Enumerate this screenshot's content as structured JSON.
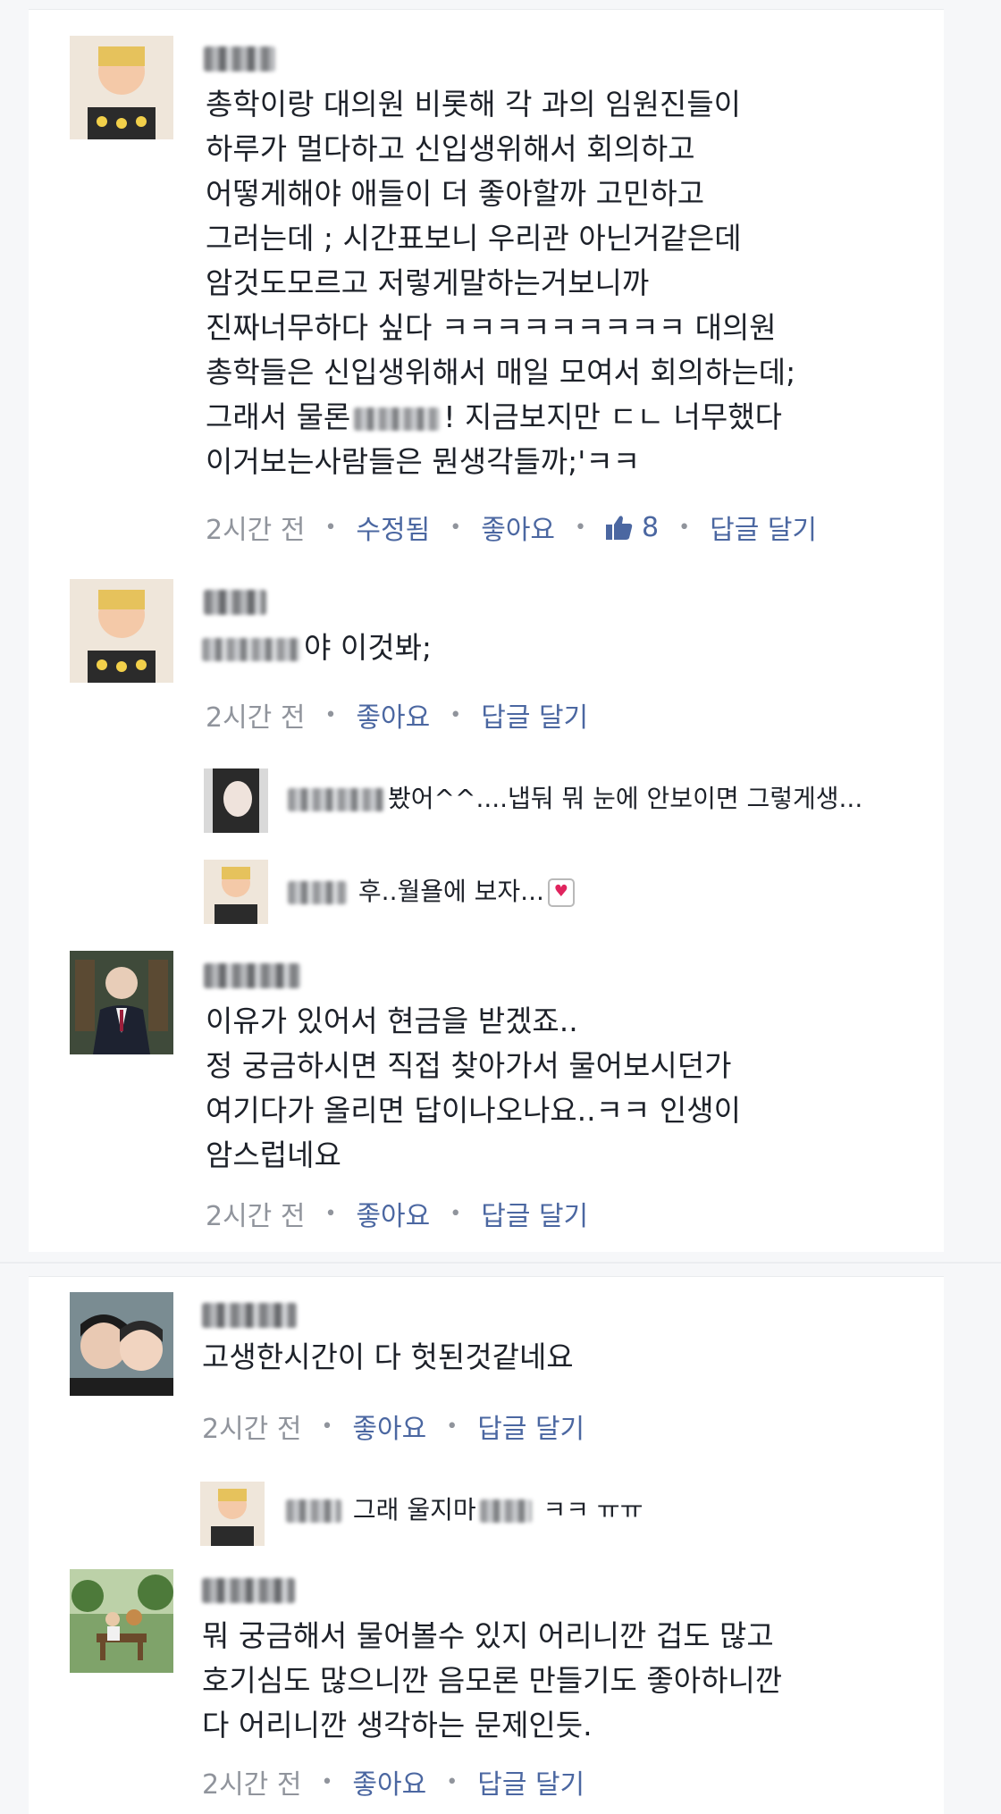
{
  "comments": [
    {
      "text": "총학이랑 대의원 비롯해 각 과의 임원진들이\n하루가 멀다하고 신입생위해서 회의하고\n어떻게해야 애들이 더 좋아할까 고민하고\n그러는데 ; 시간표보니 우리관 아닌거같은데\n암것도모르고 저렇게말하는거보니까\n진짜너무하다 싶다 ㅋㅋㅋㅋㅋㅋㅋㅋㅋ 대의원\n총학들은 신입생위해서 매일 모여서 회의하는데;\n그래서 물론",
      "text_after_blur": "! 지금보지만 ㄷㄴ 너무했다\n이거보는사람들은 뭔생각들까;'ㅋㅋ",
      "time": "2시간 전",
      "edited": "수정됨",
      "like": "좋아요",
      "like_count": "8",
      "reply": "답글 달기"
    },
    {
      "text": "야 이것봐;",
      "time": "2시간 전",
      "like": "좋아요",
      "reply": "답글 달기"
    },
    {
      "text": "이유가 있어서 현금을 받겠죠..\n정 궁금하시면 직접 찾아가서 물어보시던가\n여기다가 올리면 답이나오나요..ㅋㅋ 인생이\n암스럽네요",
      "time": "2시간 전",
      "like": "좋아요",
      "reply": "답글 달기"
    },
    {
      "text": "고생한시간이 다 헛된것같네요",
      "time": "2시간 전",
      "like": "좋아요",
      "reply": "답글 달기"
    },
    {
      "text": "뭐 궁금해서 물어볼수 있지 어리니깐 겁도 많고\n호기심도 많으니깐 음모론 만들기도 좋아하니깐\n다 어리니깐 생각하는 문제인듯.",
      "time": "2시간 전",
      "like": "좋아요",
      "reply": "답글 달기"
    }
  ],
  "replies": [
    {
      "text": "봤어^^....냅둬 뭐 눈에 안보이면 그렇게생..."
    },
    {
      "text": "후..월욜에 보자..."
    },
    {
      "text_before": "그래 울지마",
      "text_after": "ㅋㅋ ㅠㅠ"
    }
  ],
  "colors": {
    "link": "#4b67a1",
    "meta": "#90949c",
    "text": "#1d2129",
    "bg": "#f6f7f9"
  }
}
